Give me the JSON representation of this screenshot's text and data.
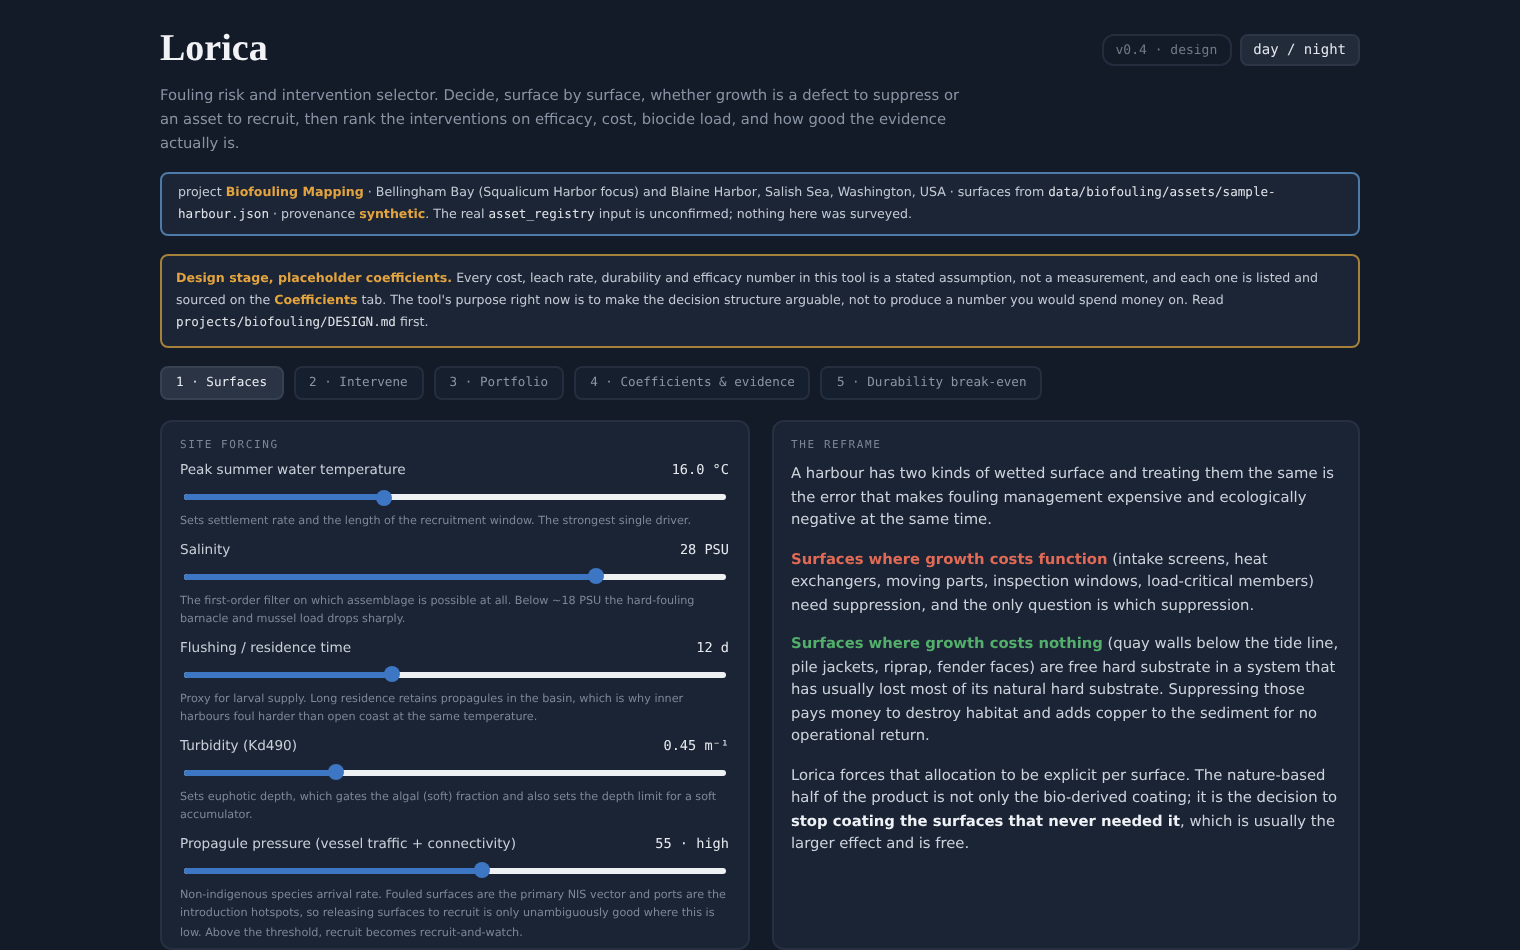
{
  "header": {
    "title": "Lorica",
    "version": "v0.4 · design",
    "theme_toggle": "day / night"
  },
  "subtitle": "Fouling risk and intervention selector. Decide, surface by surface, whether growth is a defect to suppress or an asset to recruit, then rank the interventions on efficacy, cost, biocide load, and how good the evidence actually is.",
  "project_notice": [
    {
      "kind": "text",
      "text": "project "
    },
    {
      "kind": "accent",
      "text": "Biofouling Mapping"
    },
    {
      "kind": "text",
      "text": " · Bellingham Bay (Squalicum Harbor focus) and Blaine Harbor, Salish Sea, Washington, USA · surfaces from "
    },
    {
      "kind": "code",
      "text": "data/biofouling/assets/sample-harbour.json"
    },
    {
      "kind": "text",
      "text": " · provenance "
    },
    {
      "kind": "accent",
      "text": "synthetic"
    },
    {
      "kind": "text",
      "text": ". The real "
    },
    {
      "kind": "code",
      "text": "asset_registry"
    },
    {
      "kind": "text",
      "text": " input is unconfirmed; nothing here was surveyed."
    }
  ],
  "design_notice": [
    {
      "kind": "accent",
      "text": "Design stage, placeholder coefficients."
    },
    {
      "kind": "text",
      "text": " Every cost, leach rate, durability and efficacy number in this tool is a stated assumption, not a measurement, and each one is listed and sourced on the "
    },
    {
      "kind": "accent",
      "text": "Coefficients"
    },
    {
      "kind": "text",
      "text": " tab. The tool's purpose right now is to make the decision structure arguable, not to produce a number you would spend money on. Read "
    },
    {
      "kind": "code",
      "text": "projects/biofouling/DESIGN.md"
    },
    {
      "kind": "text",
      "text": " first."
    }
  ],
  "tabs": [
    {
      "label": "1 · Surfaces",
      "selected": true
    },
    {
      "label": "2 · Intervene",
      "selected": false
    },
    {
      "label": "3 · Portfolio",
      "selected": false
    },
    {
      "label": "4 · Coefficients & evidence",
      "selected": false
    },
    {
      "label": "5 · Durability break-even",
      "selected": false
    }
  ],
  "forcing_panel": {
    "heading": "SITE FORCING",
    "controls": [
      {
        "label": "Peak summer water temperature",
        "reading": "16.0 °C",
        "level": 0.37,
        "note": "Sets settlement rate and the length of the recruitment window. The strongest single driver."
      },
      {
        "label": "Salinity",
        "reading": "28 PSU",
        "level": 0.76,
        "note": "The first-order filter on which assemblage is possible at all. Below ~18 PSU the hard-fouling barnacle and mussel load drops sharply."
      },
      {
        "label": "Flushing / residence time",
        "reading": "12 d",
        "level": 0.385,
        "note": "Proxy for larval supply. Long residence retains propagules in the basin, which is why inner harbours foul harder than open coast at the same temperature."
      },
      {
        "label": "Turbidity (Kd490)",
        "reading": "0.45 m⁻¹",
        "level": 0.28,
        "note": "Sets euphotic depth, which gates the algal (soft) fraction and also sets the depth limit for a soft accumulator."
      },
      {
        "label": "Propagule pressure (vessel traffic + connectivity)",
        "reading": "55 · high",
        "level": 0.55,
        "note": "Non-indigenous species arrival rate. Fouled surfaces are the primary NIS vector and ports are the introduction hotspots, so releasing surfaces to recruit is only unambiguously good where this is low. Above the threshold, recruit becomes recruit-and-watch."
      }
    ]
  },
  "reframe_panel": {
    "heading": "THE REFRAME",
    "paragraphs": [
      [
        {
          "kind": "text",
          "text": "A harbour has two kinds of wetted surface and treating them the same is the error that makes fouling management expensive and ecologically negative at the same time."
        }
      ],
      [
        {
          "kind": "warn",
          "text": "Surfaces where growth costs function"
        },
        {
          "kind": "text",
          "text": " (intake screens, heat exchangers, moving parts, inspection windows, load-critical members) need suppression, and the only question is which suppression."
        }
      ],
      [
        {
          "kind": "good",
          "text": "Surfaces where growth costs nothing"
        },
        {
          "kind": "text",
          "text": " (quay walls below the tide line, pile jackets, riprap, fender faces) are free hard substrate in a system that has usually lost most of its natural hard substrate. Suppressing those pays money to destroy habitat and adds copper to the sediment for no operational return."
        }
      ],
      [
        {
          "kind": "text",
          "text": "Lorica forces that allocation to be explicit per surface. The nature-based half of the product is not only the bio-derived coating; it is the decision to "
        },
        {
          "kind": "bold",
          "text": "stop coating the surfaces that never needed it"
        },
        {
          "kind": "text",
          "text": ", which is usually the larger effect and is free."
        }
      ]
    ]
  }
}
